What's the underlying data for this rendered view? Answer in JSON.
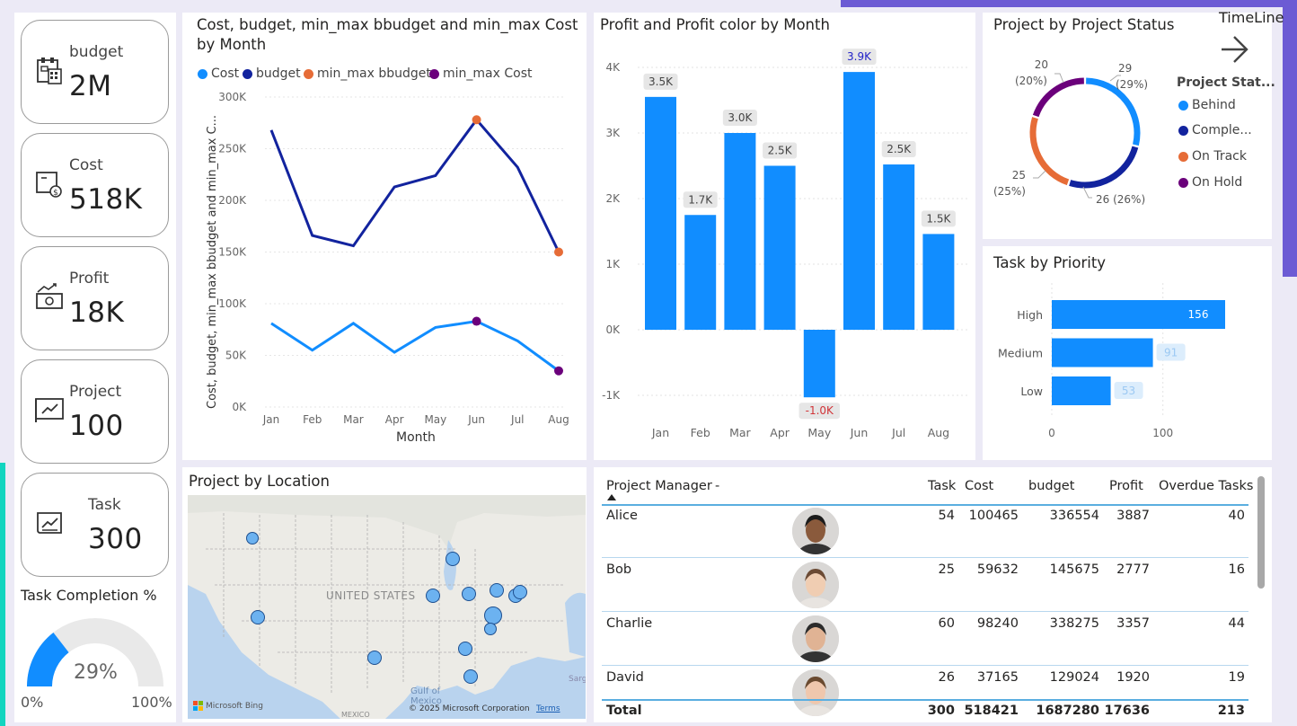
{
  "kpis": [
    {
      "label": "budget",
      "value": "2M",
      "icon": "calculator-icon"
    },
    {
      "label": "Cost",
      "value": "518K",
      "icon": "money-box-icon"
    },
    {
      "label": "Profit",
      "value": "18K",
      "icon": "profit-chart-icon"
    },
    {
      "label": "Project",
      "value": "100",
      "icon": "project-board-icon"
    },
    {
      "label": "Task",
      "value": "300",
      "icon": "task-scroll-icon"
    }
  ],
  "task_completion": {
    "title": "Task Completion %",
    "value": "29%",
    "percent": 29,
    "min": "0%",
    "max": "100%"
  },
  "timeline": {
    "label": "TimeLine",
    "icon": "arrow-right-icon"
  },
  "line_chart": {
    "title": "Cost, budget, min_max bbudget and min_max Cost by Month",
    "legend": [
      {
        "name": "Cost",
        "color": "#118dff"
      },
      {
        "name": "budget",
        "color": "#12239e"
      },
      {
        "name": "min_max bbudget",
        "color": "#e66c37"
      },
      {
        "name": "min_max Cost",
        "color": "#6b007b"
      }
    ],
    "ylabel": "Cost, budget, min_max bbudget and min_max C...",
    "xlabel": "Month",
    "yticks": [
      "300K",
      "250K",
      "200K",
      "150K",
      "100K",
      "50K",
      "0K"
    ]
  },
  "bar_chart": {
    "title": "Profit and Profit color by Month",
    "yticks": [
      "4K",
      "3K",
      "2K",
      "1K",
      "0K",
      "-1K"
    ]
  },
  "donut": {
    "title": "Project by Project Status",
    "legend_title": "Project Stat...",
    "legend": [
      {
        "name": "Behind",
        "color": "#118dff"
      },
      {
        "name": "Comple...",
        "color": "#12239e"
      },
      {
        "name": "On Track",
        "color": "#e66c37"
      },
      {
        "name": "On Hold",
        "color": "#6b007b"
      }
    ],
    "labels": {
      "behind": "29",
      "behind_pct": "(29%)",
      "completed": "26 (26%)",
      "ontrack": "25",
      "ontrack_pct": "(25%)",
      "onhold": "20",
      "onhold_pct": "(20%)"
    }
  },
  "priority": {
    "title": "Task by Priority",
    "xticks": [
      "0",
      "100"
    ]
  },
  "map": {
    "title": "Project by Location",
    "country": "UNITED STATES",
    "gulf": "Gulf of Mexico",
    "mexico": "MEXICO",
    "copyright": "© 2025 Microsoft Corporation",
    "terms": "Terms",
    "bing": "Microsoft Bing",
    "sarg": "Sarg"
  },
  "table": {
    "headers": {
      "manager": "Project Manager",
      "sort": "-",
      "task": "Task",
      "cost": "Cost",
      "budget": "budget",
      "profit": "Profit",
      "overdue": "Overdue Tasks"
    },
    "rows": [
      {
        "name": "Alice",
        "task": "54",
        "cost": "100465",
        "budget": "336554",
        "profit": "3887",
        "overdue": "40"
      },
      {
        "name": "Bob",
        "task": "25",
        "cost": "59632",
        "budget": "145675",
        "profit": "2777",
        "overdue": "16"
      },
      {
        "name": "Charlie",
        "task": "60",
        "cost": "98240",
        "budget": "338275",
        "profit": "3357",
        "overdue": "44"
      },
      {
        "name": "David",
        "task": "26",
        "cost": "37165",
        "budget": "129024",
        "profit": "1920",
        "overdue": "19"
      }
    ],
    "total": {
      "label": "Total",
      "task": "300",
      "cost": "518421",
      "budget": "1687280",
      "profit": "17636",
      "overdue": "213"
    }
  },
  "chart_data": [
    {
      "type": "line",
      "title": "Cost, budget, min_max bbudget and min_max Cost by Month",
      "categories": [
        "Jan",
        "Feb",
        "Mar",
        "Apr",
        "May",
        "Jun",
        "Jul",
        "Aug"
      ],
      "series": [
        {
          "name": "Cost",
          "values": [
            81000,
            55000,
            81000,
            53000,
            77000,
            83000,
            64000,
            35000
          ]
        },
        {
          "name": "budget",
          "values": [
            268000,
            166000,
            156000,
            213000,
            224000,
            278000,
            232000,
            150000
          ]
        },
        {
          "name": "min_max bbudget",
          "points": [
            {
              "x": "Jun",
              "y": 278000
            },
            {
              "x": "Aug",
              "y": 150000
            }
          ]
        },
        {
          "name": "min_max Cost",
          "points": [
            {
              "x": "Jun",
              "y": 83000
            },
            {
              "x": "Aug",
              "y": 35000
            }
          ]
        }
      ],
      "xlabel": "Month",
      "ylabel": "Cost, budget, min_max bbudget and min_max C...",
      "ylim": [
        0,
        300000
      ]
    },
    {
      "type": "bar",
      "title": "Profit and Profit color by Month",
      "categories": [
        "Jan",
        "Feb",
        "Mar",
        "Apr",
        "May",
        "Jun",
        "Jul",
        "Aug"
      ],
      "values": [
        3550,
        1750,
        3000,
        2500,
        -1030,
        3930,
        2520,
        1460
      ],
      "labels": [
        "3.5K",
        "1.7K",
        "3.0K",
        "2.5K",
        "-1.0K",
        "3.9K",
        "2.5K",
        "1.5K"
      ],
      "ylim": [
        -1000,
        4000
      ]
    },
    {
      "type": "pie",
      "title": "Project by Project Status",
      "categories": [
        "Behind",
        "Completed",
        "On Track",
        "On Hold"
      ],
      "values": [
        29,
        26,
        25,
        20
      ]
    },
    {
      "type": "bar",
      "title": "Task by Priority",
      "orientation": "horizontal",
      "categories": [
        "High",
        "Medium",
        "Low"
      ],
      "values": [
        156,
        91,
        53
      ],
      "xlim": [
        0,
        156
      ]
    }
  ]
}
